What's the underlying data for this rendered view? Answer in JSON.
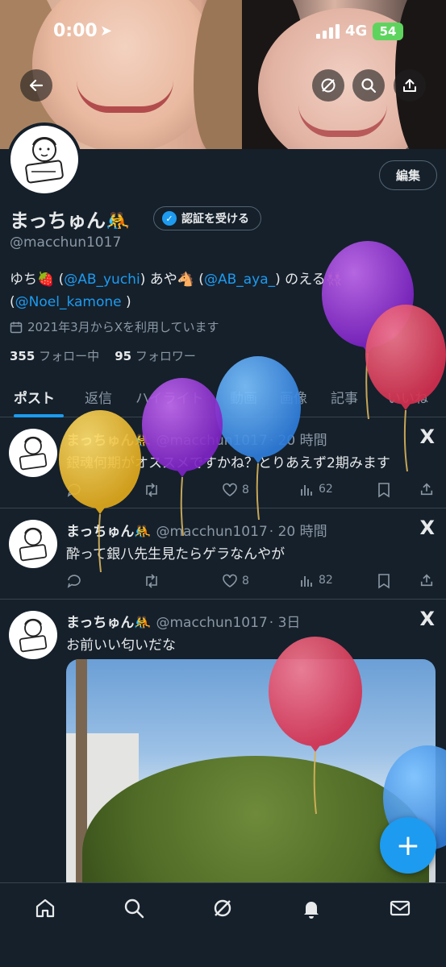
{
  "status_bar": {
    "time": "0:00",
    "network": "4G",
    "battery": "54"
  },
  "header": {
    "back_icon": "arrow-left-icon",
    "grok_icon": "grok-icon",
    "search_icon": "search-icon",
    "share_icon": "share-icon"
  },
  "profile": {
    "edit_label": "編集",
    "display_name": "まっちゅん🤼",
    "verify_label": "認証を受ける",
    "handle": "@macchun1017",
    "bio_part1": "ゆち🍓 (",
    "bio_mention1": "@AB_yuchi",
    "bio_part2": ") あや🐴 (",
    "bio_mention2": "@AB_aya_",
    "bio_part3": ") のえる👯",
    "bio_part4": "(",
    "bio_mention3": "@Noel_kamone",
    "bio_part5": " )",
    "joined": "2021年3月からXを利用しています",
    "following_count": "355",
    "following_label": "フォロー中",
    "followers_count": "95",
    "followers_label": "フォロワー"
  },
  "tabs": [
    "ポスト",
    "返信",
    "ハイライト",
    "動画",
    "画像",
    "記事",
    "いいね"
  ],
  "tweets": [
    {
      "name": "まっちゅん🤼",
      "handle": "@macchun1017",
      "time": "· 20 時間",
      "text": "銀魂何期がオススメですかね？とりあえず2期みます",
      "likes": "8",
      "views": "62"
    },
    {
      "name": "まっちゅん🤼",
      "handle": "@macchun1017",
      "time": "· 20 時間",
      "text": "酔って銀八先生見たらゲラなんやが",
      "likes": "8",
      "views": "82"
    },
    {
      "name": "まっちゅん🤼",
      "handle": "@macchun1017",
      "time": "· 3日",
      "text": "お前いい匂いだな"
    }
  ],
  "nav": [
    "home-icon",
    "search-icon",
    "grok-icon",
    "notifications-icon",
    "messages-icon"
  ],
  "colors": {
    "accent": "#1d9bf0",
    "background": "#15202b",
    "muted": "#8b98a5"
  }
}
